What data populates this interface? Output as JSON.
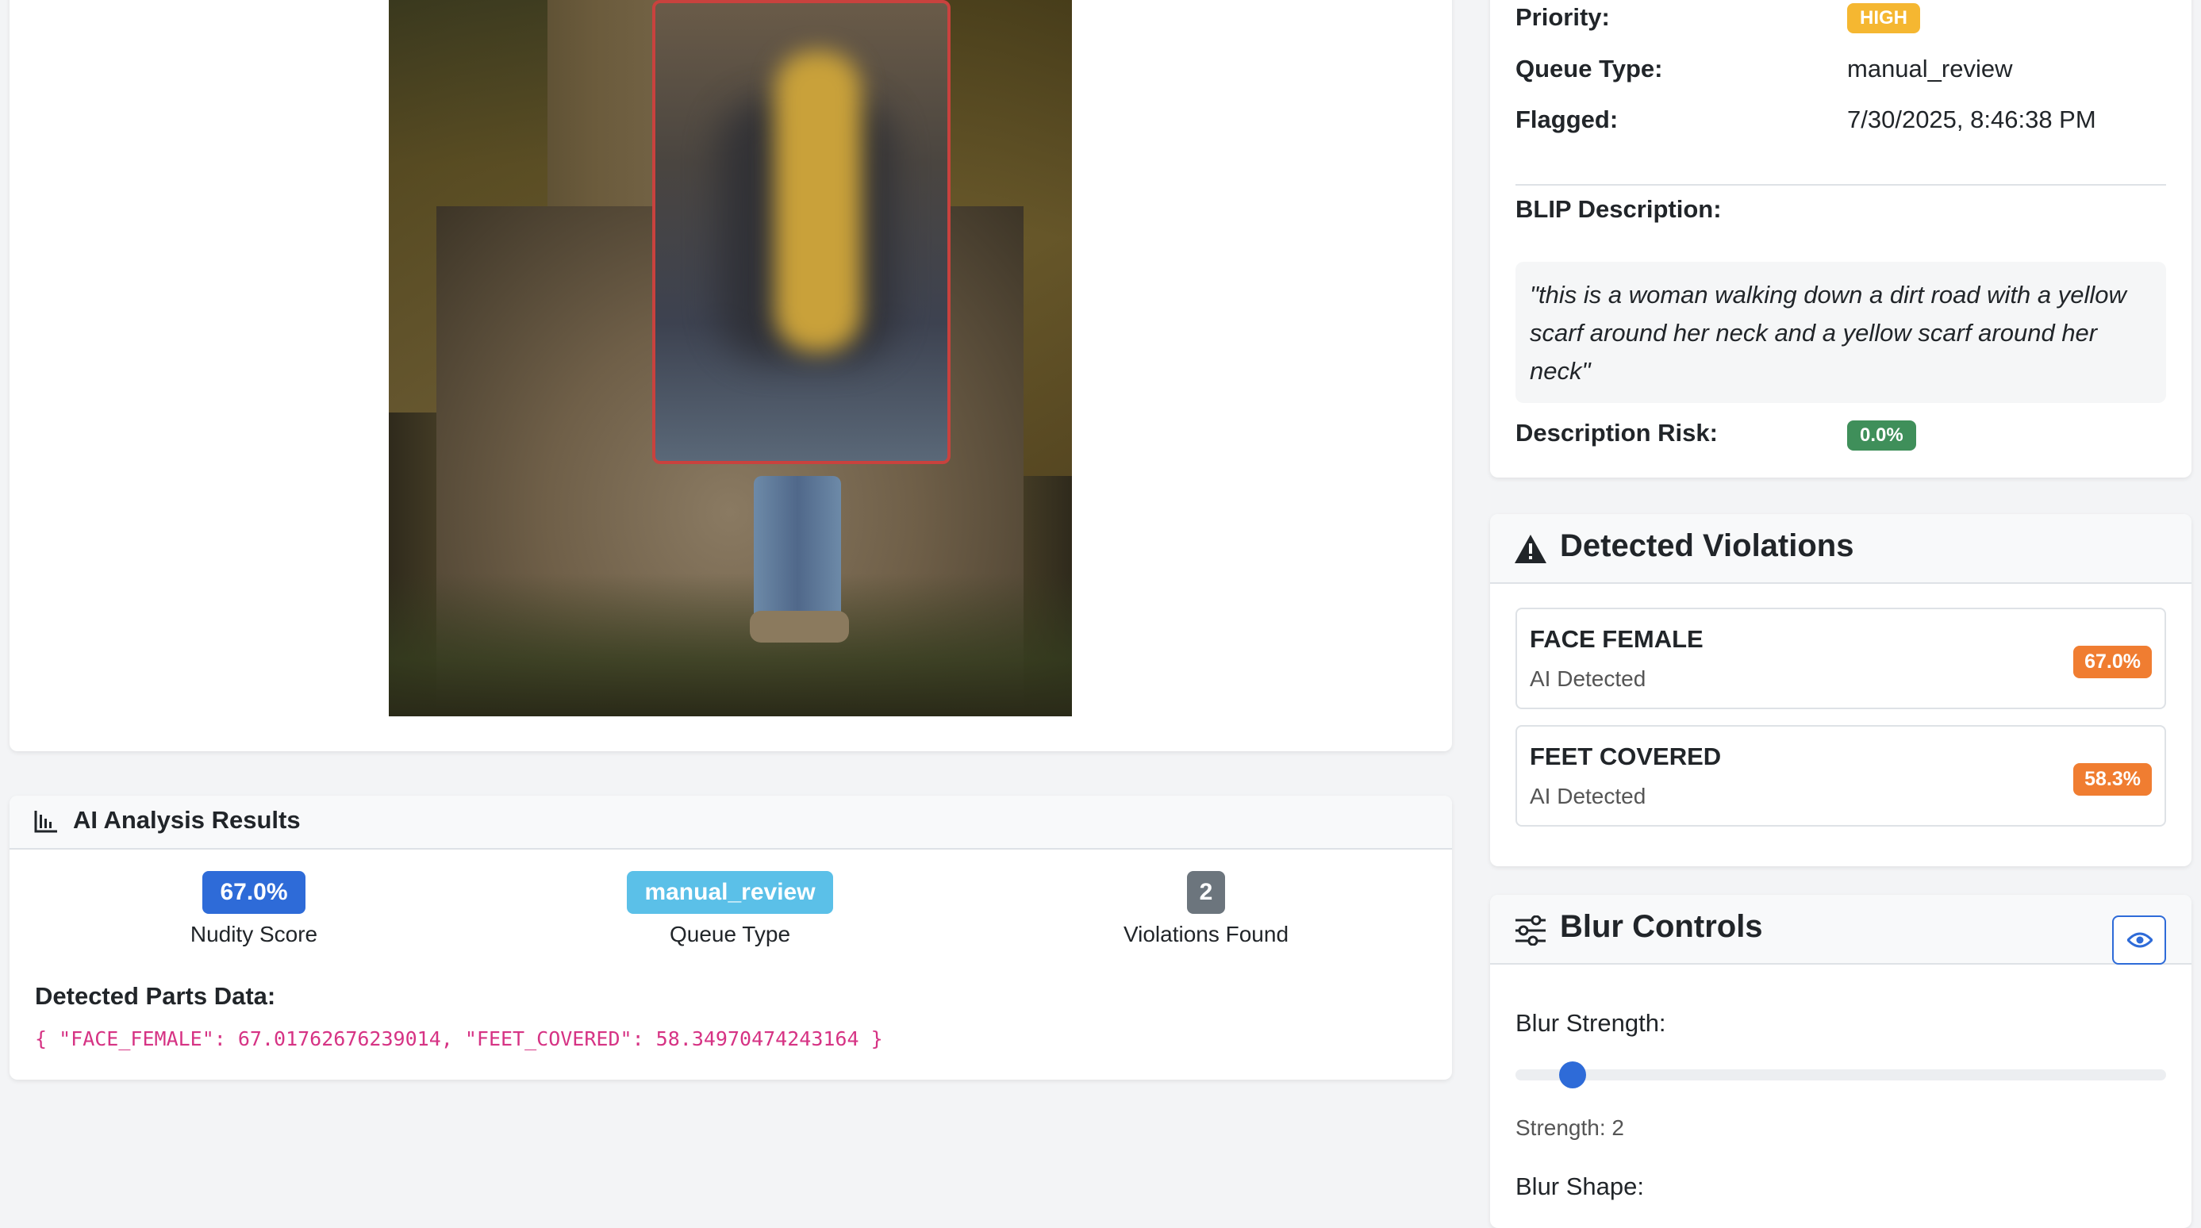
{
  "analysis": {
    "title": "AI Analysis Results",
    "nudity_score": "67.0%",
    "nudity_label": "Nudity Score",
    "queue_type": "manual_review",
    "queue_label": "Queue Type",
    "violations_count": "2",
    "violations_label": "Violations Found",
    "parts_heading": "Detected Parts Data:",
    "parts_json": "{ \"FACE_FEMALE\": 67.01762676239014, \"FEET_COVERED\": 58.34970474243164 }"
  },
  "details": {
    "priority_label": "Priority:",
    "priority_value": "HIGH",
    "queue_type_label": "Queue Type:",
    "queue_type_value": "manual_review",
    "flagged_label": "Flagged:",
    "flagged_value": "7/30/2025, 8:46:38 PM",
    "blip_label": "BLIP Description:",
    "blip_text": "\"this is a woman walking down a dirt road with a yellow scarf around her neck and a yellow scarf around her neck\"",
    "description_risk_label": "Description Risk:",
    "description_risk_value": "0.0%"
  },
  "violations": {
    "title": "Detected Violations",
    "items": [
      {
        "name": "FACE FEMALE",
        "source": "AI Detected",
        "score": "67.0%"
      },
      {
        "name": "FEET COVERED",
        "source": "AI Detected",
        "score": "58.3%"
      }
    ]
  },
  "blur_controls": {
    "title": "Blur Controls",
    "strength_label": "Blur Strength:",
    "strength_value": 2,
    "strength_text": "Strength: 2",
    "strength_min": 1,
    "strength_max": 50,
    "shape_label": "Blur Shape:"
  },
  "colors": {
    "primary": "#2e6bd8",
    "info": "#5bc0e8",
    "secondary": "#6c757d",
    "warning": "#f5b731",
    "success": "#3f8f5a",
    "violation": "#f07d31",
    "blur_box_border": "#c9423e",
    "code": "#d63384"
  }
}
